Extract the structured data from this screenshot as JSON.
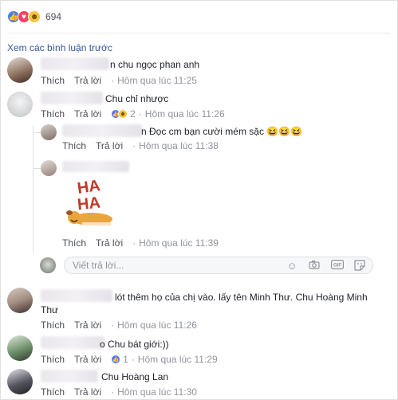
{
  "reactions": {
    "count": "694"
  },
  "previous_comments": "Xem các bình luận trước",
  "actions": {
    "like": "Thích",
    "reply": "Trả lời"
  },
  "comments": [
    {
      "text": "n chu ngọc phan anh",
      "time": "Hôm qua lúc 11:25",
      "count": ""
    },
    {
      "text": "Chu chỉ nhược",
      "time": "Hôm qua lúc 11:26",
      "count": "2"
    },
    {
      "text": "n Đọc cm bạn cười mém sặc 😆😆😆",
      "time": "Hôm qua lúc 11:38",
      "count": ""
    },
    {
      "text": "",
      "time": "Hôm qua lúc 11:39",
      "count": ""
    },
    {
      "text": "lót thêm họ của chị vào. lấy tên Minh Thư. Chu Hoàng Minh",
      "text2": "Thư",
      "time": "Hôm qua lúc 11:26",
      "count": ""
    },
    {
      "text": "o Chu bát giới:))",
      "time": "Hôm qua lúc 11:29",
      "count": "1"
    },
    {
      "text": "Chu Hoàng Lan",
      "time": "Hôm qua lúc 11:30",
      "count": ""
    }
  ],
  "reply_input": {
    "placeholder": "Viết trả lời..."
  },
  "sticker_text": {
    "line1": "HA",
    "line2": "HA"
  },
  "icons": [
    "like-icon",
    "love-icon",
    "haha-icon",
    "smiley-icon",
    "camera-icon",
    "gif-icon",
    "sticker-icon"
  ]
}
